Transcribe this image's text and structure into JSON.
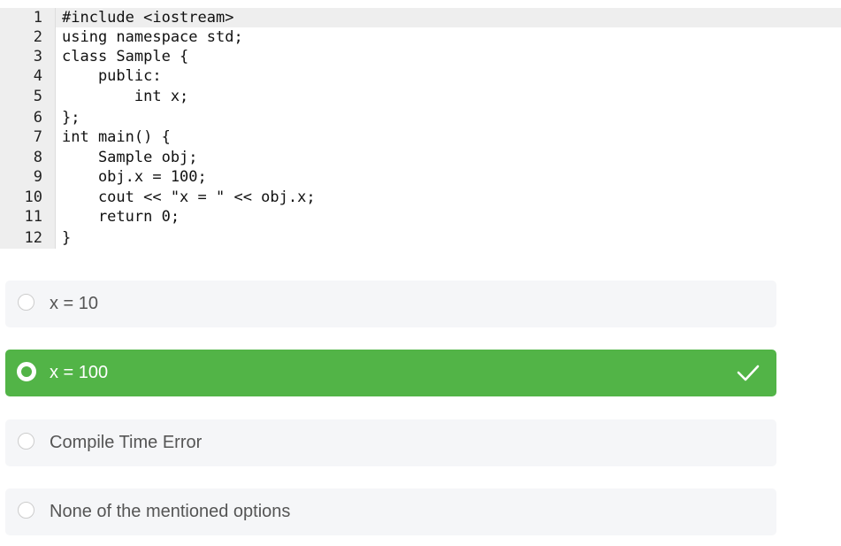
{
  "code": {
    "lines": [
      {
        "number": "1",
        "text": "#include <iostream>"
      },
      {
        "number": "2",
        "text": "using namespace std;"
      },
      {
        "number": "3",
        "text": "class Sample {"
      },
      {
        "number": "4",
        "text": "    public:"
      },
      {
        "number": "5",
        "text": "        int x;"
      },
      {
        "number": "6",
        "text": "};"
      },
      {
        "number": "7",
        "text": "int main() {"
      },
      {
        "number": "8",
        "text": "    Sample obj;"
      },
      {
        "number": "9",
        "text": "    obj.x = 100;"
      },
      {
        "number": "10",
        "text": "    cout << \"x = \" << obj.x;"
      },
      {
        "number": "11",
        "text": "    return 0;"
      },
      {
        "number": "12",
        "text": "}"
      }
    ]
  },
  "options": [
    {
      "label": "x = 10",
      "selected": false
    },
    {
      "label": "x = 100",
      "selected": true
    },
    {
      "label": "Compile Time Error",
      "selected": false
    },
    {
      "label": "None of the mentioned options",
      "selected": false
    }
  ],
  "colors": {
    "correct": "#52b447",
    "option_bg": "#f5f6f8",
    "gutter_bg": "#eeeeee"
  },
  "icons": {
    "correct_marker": "check-icon"
  }
}
